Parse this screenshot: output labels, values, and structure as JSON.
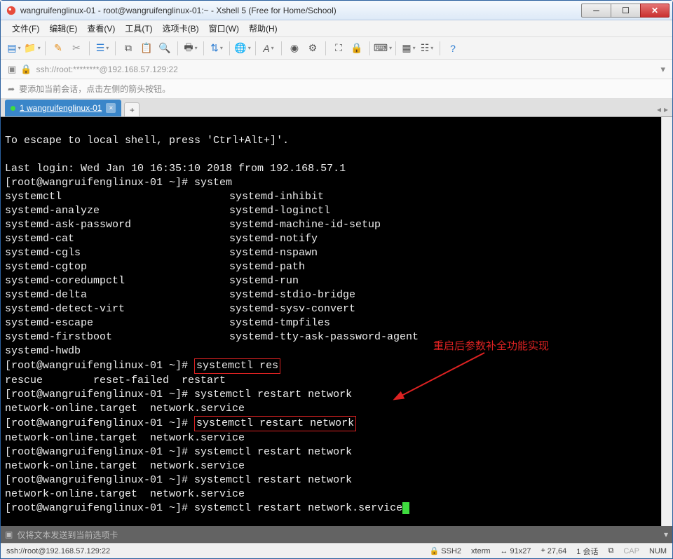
{
  "title": "wangruifenglinux-01 - root@wangruifenglinux-01:~ - Xshell 5 (Free for Home/School)",
  "menus": {
    "file": "文件(F)",
    "edit": "编辑(E)",
    "view": "查看(V)",
    "tools": "工具(T)",
    "tabs": "选项卡(B)",
    "window": "窗口(W)",
    "help": "帮助(H)"
  },
  "address": "ssh://root:********@192.168.57.129:22",
  "infobar": "要添加当前会话，点击左侧的箭头按钮。",
  "tab": {
    "label": "1 wangruifenglinux-01"
  },
  "terminal": {
    "escape": "To escape to local shell, press 'Ctrl+Alt+]'.",
    "blank1": "",
    "lastlogin": "Last login: Wed Jan 10 16:35:10 2018 from 192.168.57.1",
    "prompt1": "[root@wangruifenglinux-01 ~]# system",
    "col_l": {
      "r1": "systemctl",
      "r2": "systemd-analyze",
      "r3": "systemd-ask-password",
      "r4": "systemd-cat",
      "r5": "systemd-cgls",
      "r6": "systemd-cgtop",
      "r7": "systemd-coredumpctl",
      "r8": "systemd-delta",
      "r9": "systemd-detect-virt",
      "r10": "systemd-escape",
      "r11": "systemd-firstboot",
      "r12": "systemd-hwdb"
    },
    "col_r": {
      "r1": "systemd-inhibit",
      "r2": "systemd-loginctl",
      "r3": "systemd-machine-id-setup",
      "r4": "systemd-notify",
      "r5": "systemd-nspawn",
      "r6": "systemd-path",
      "r7": "systemd-run",
      "r8": "systemd-stdio-bridge",
      "r9": "systemd-sysv-convert",
      "r10": "systemd-tmpfiles",
      "r11": "systemd-tty-ask-password-agent"
    },
    "prompt2_pre": "[root@wangruifenglinux-01 ~]# ",
    "prompt2_box": "systemctl res",
    "rescue_line": "rescue        reset-failed  restart",
    "prompt3": "[root@wangruifenglinux-01 ~]# systemctl restart network",
    "netline": "network-online.target  network.service",
    "prompt4_pre": "[root@wangruifenglinux-01 ~]# ",
    "prompt4_box": "systemctl restart network",
    "prompt5": "[root@wangruifenglinux-01 ~]# systemctl restart network",
    "prompt6": "[root@wangruifenglinux-01 ~]# systemctl restart network",
    "prompt7_pre": "[root@wangruifenglinux-01 ~]# systemctl restart network.service",
    "annotation": "重启后参数补全功能实现"
  },
  "inputbar_placeholder": "仅将文本发送到当前选项卡",
  "status": {
    "left": "ssh://root@192.168.57.129:22",
    "ssh": "SSH2",
    "term": "xterm",
    "size": "91x27",
    "pos": "27,64",
    "sessions": "1 会话",
    "cap": "CAP",
    "num": "NUM"
  }
}
